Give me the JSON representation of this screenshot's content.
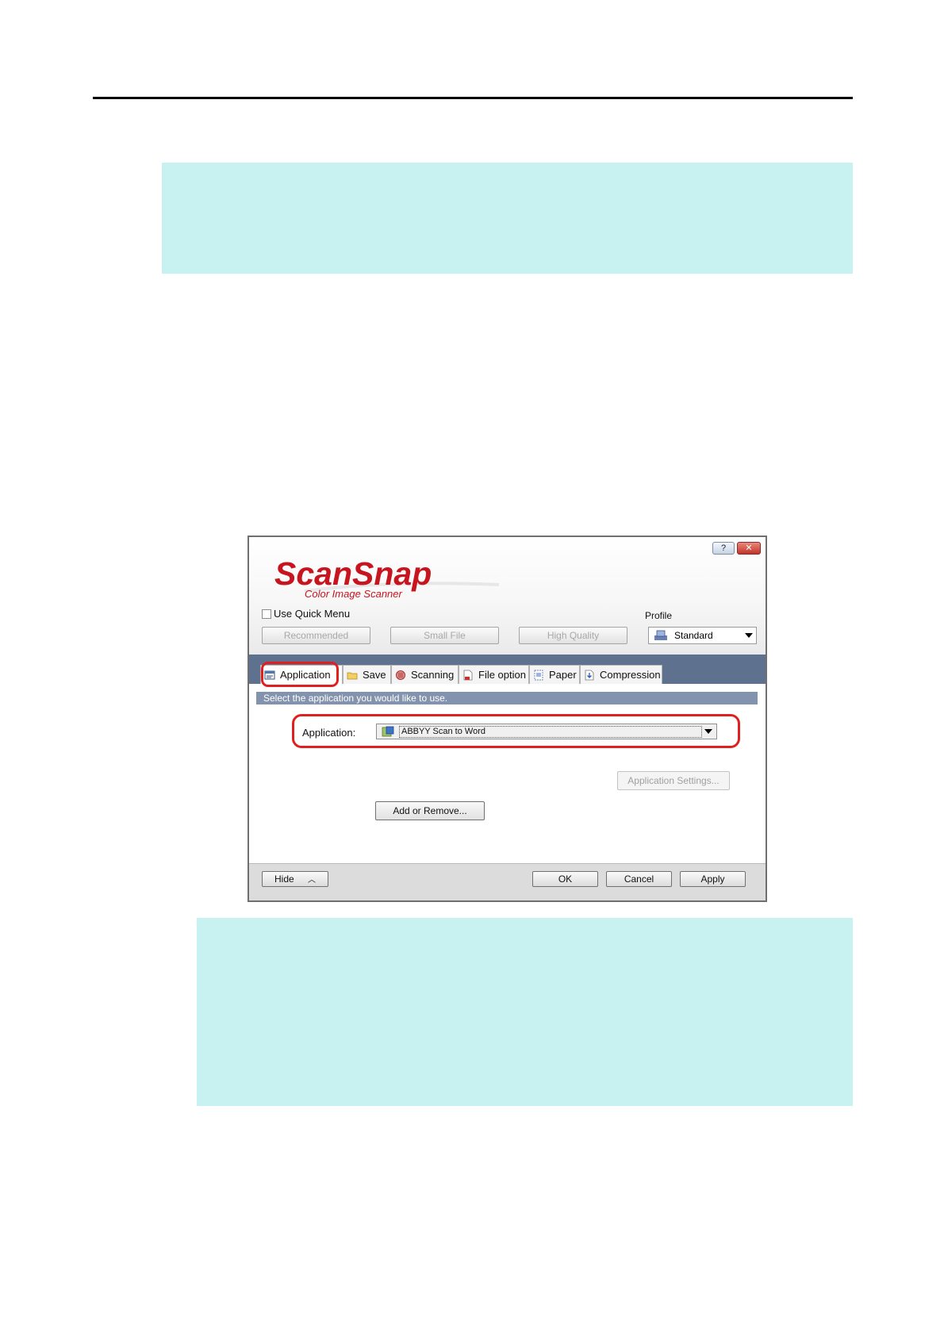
{
  "dialog": {
    "title_buttons": {
      "help": "?",
      "close": "✕"
    },
    "logo": {
      "brand": "ScanSnap",
      "tagline": "Color Image Scanner"
    },
    "quick_menu_label": "Use Quick Menu",
    "quick_menu_checked": false,
    "presets": [
      "Recommended",
      "Small File",
      "High Quality"
    ],
    "profile": {
      "label": "Profile",
      "value": "Standard"
    },
    "tabs": [
      {
        "label": "Application",
        "icon": "application-tab-icon",
        "active": true
      },
      {
        "label": "Save",
        "icon": "folder-icon"
      },
      {
        "label": "Scanning",
        "icon": "scanning-icon"
      },
      {
        "label": "File option",
        "icon": "file-option-icon"
      },
      {
        "label": "Paper",
        "icon": "paper-icon"
      },
      {
        "label": "Compression",
        "icon": "compression-icon"
      }
    ],
    "panel": {
      "info": "Select the application you would like to use.",
      "application_label": "Application:",
      "application_value": "ABBYY Scan to Word",
      "app_settings_button": "Application Settings...",
      "add_remove_button": "Add or Remove..."
    },
    "footer": {
      "hide": "Hide",
      "ok": "OK",
      "cancel": "Cancel",
      "apply": "Apply"
    }
  },
  "colors": {
    "note_background": "#c8f2f2",
    "highlight_ring": "#e0201e",
    "logo_red": "#c8141e",
    "tab_strip": "#5e7290",
    "info_bar": "#8393ad"
  }
}
